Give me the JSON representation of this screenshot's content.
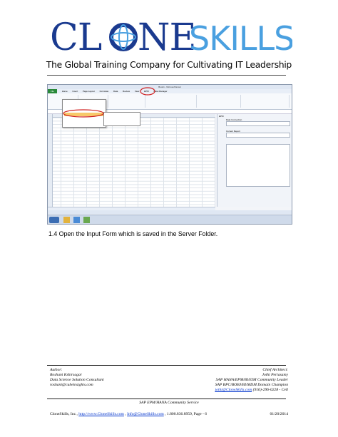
{
  "brand": {
    "logo_text": "CLONESKILLS",
    "logo_color": "#1a3a8f"
  },
  "tagline": "The Global Training Company for Cultivating IT Leadership",
  "screenshot": {
    "window_title": "Book1 - Microsoft Excel",
    "tabs": [
      "File",
      "Home",
      "Insert",
      "Page Layout",
      "Formulas",
      "Data",
      "Review",
      "View",
      "EPM",
      "Data Manager"
    ],
    "menu_highlight_color": "#f7c96a",
    "annotation_color": "#d02020",
    "pane_title": "EPM",
    "pane_sections": [
      "Data Connection",
      "Current Report"
    ]
  },
  "caption": "1.4 Open the Input Form which is saved in the Server Folder.",
  "footer": {
    "left": {
      "role": "Author:",
      "name": "Roshani Kshirsagar",
      "title": "Data Science Solution Consultant",
      "email": "roshani@cubeinsights.com"
    },
    "right": {
      "role": "Chief Architect:",
      "name": "Jothi Periasamy",
      "title1": "SAP HANA/EPM/BI/EIM Community Leader",
      "title2": "SAP BPC/BOBJ/BI/MDM Domain Champion",
      "contact_email": "jothi@CloneSkills.com",
      "contact_phone": " (916)-296-0228 - Cell"
    },
    "community": "SAP EPM/HANA Community Service",
    "company_prefix": "CloneSkills, Inc., ",
    "company_url": "http://www.CloneSkills.com",
    "sep": " , ",
    "company_email": "Info@CloneSkills.com",
    "company_tail": " , 1.800.836.8959, Page - 6",
    "date": "01/20/2014"
  }
}
